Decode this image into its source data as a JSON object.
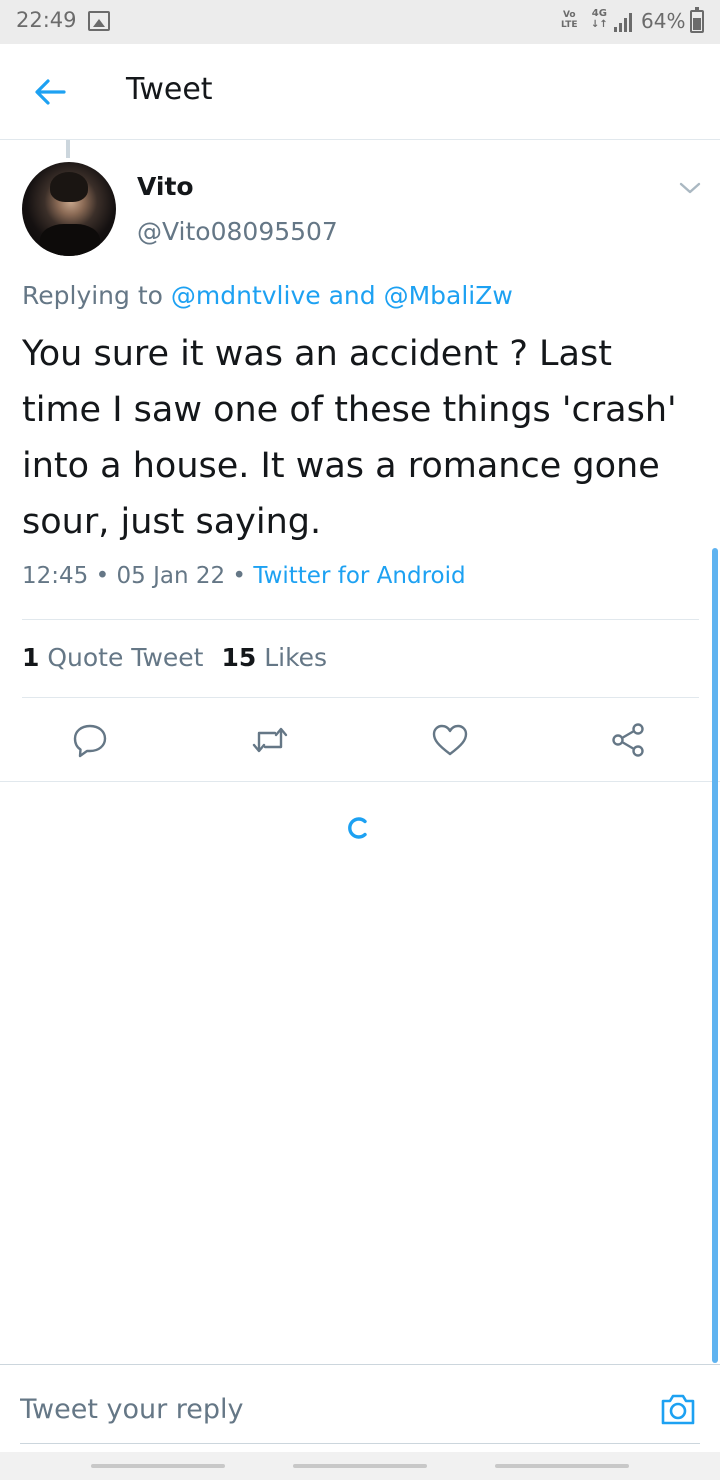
{
  "status_bar": {
    "time": "22:49",
    "volte_line1": "Vo",
    "volte_line2": "LTE",
    "network": "4G",
    "battery": "64%"
  },
  "header": {
    "title": "Tweet",
    "back_icon": "arrow-left-icon"
  },
  "tweet": {
    "display_name": "Vito",
    "handle": "@Vito08095507",
    "replying_prefix": "Replying to ",
    "reply_to_1": "@mdntvlive",
    "reply_joiner": " and ",
    "reply_to_2": "@MbaliZw",
    "text": "You sure it was an accident ? Last time I saw one of these things 'crash' into a house. It was a romance gone sour, just saying.",
    "time": "12:45",
    "date": "05 Jan 22",
    "separator": " • ",
    "source": "Twitter for Android",
    "quote_tweets_count": "1",
    "quote_tweets_label": "Quote Tweet",
    "likes_count": "15",
    "likes_label": "Likes"
  },
  "actions": {
    "icons": [
      "reply-icon",
      "retweet-icon",
      "like-icon",
      "share-icon"
    ],
    "accent_color": "#1da1f2",
    "icon_color": "#657786"
  },
  "reply_bar": {
    "placeholder": "Tweet your reply",
    "camera_icon": "camera-icon"
  }
}
